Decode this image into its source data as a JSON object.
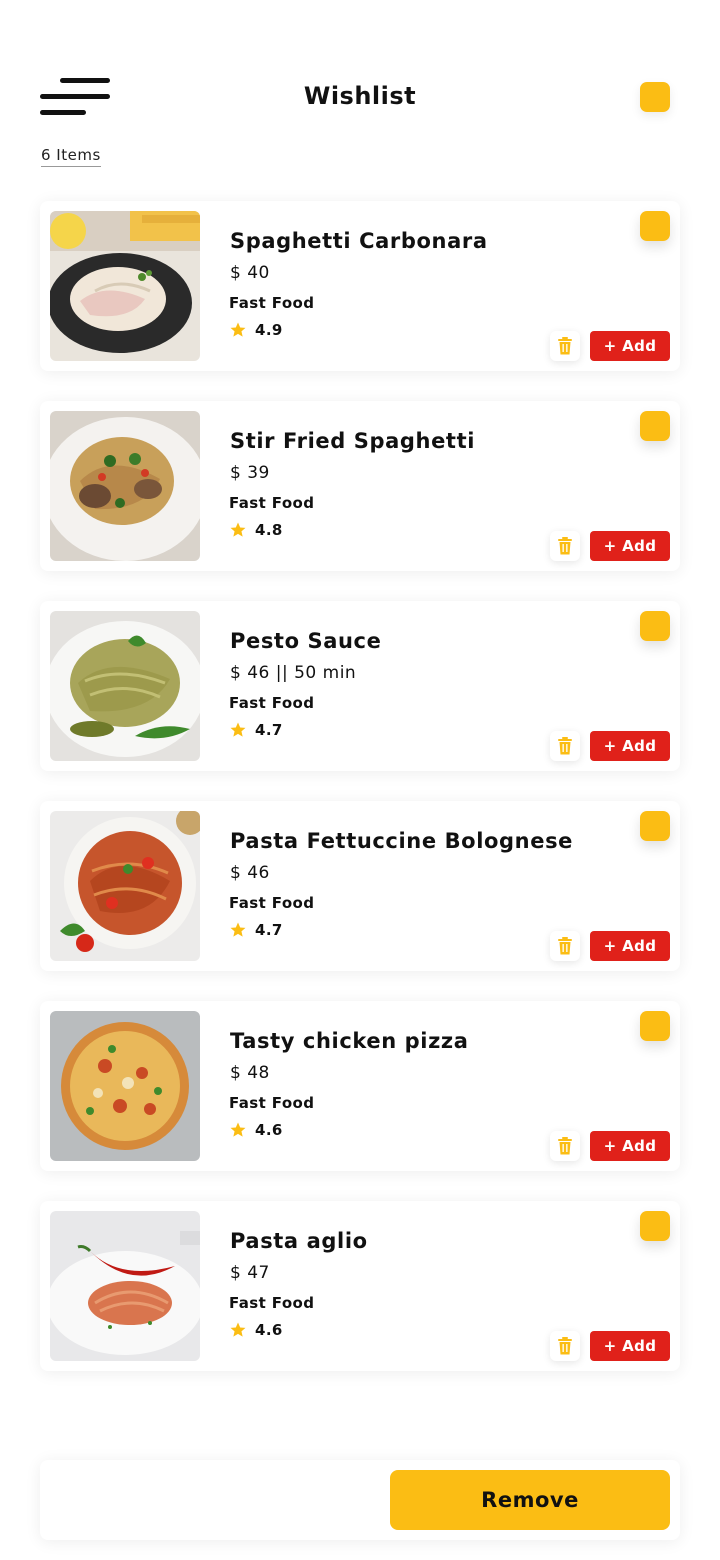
{
  "header": {
    "title": "Wishlist",
    "items_count": "6 Items",
    "menu_icon": "hamburger-menu-icon",
    "select_all_checked": true
  },
  "colors": {
    "accent_yellow": "#fbbd14",
    "add_red": "#e0211a"
  },
  "items": [
    {
      "name": "Spaghetti Carbonara",
      "price": "$ 40",
      "category": "Fast Food",
      "rating": "4.9",
      "add_label": "+ Add",
      "checked": true
    },
    {
      "name": "Stir Fried Spaghetti",
      "price": "$ 39",
      "category": "Fast Food",
      "rating": "4.8",
      "add_label": "+ Add",
      "checked": true
    },
    {
      "name": "Pesto Sauce",
      "price": "$ 46 || 50 min",
      "category": "Fast Food",
      "rating": "4.7",
      "add_label": "+ Add",
      "checked": true
    },
    {
      "name": "Pasta Fettuccine Bolognese",
      "price": "$ 46",
      "category": "Fast Food",
      "rating": "4.7",
      "add_label": "+ Add",
      "checked": true
    },
    {
      "name": "Tasty chicken pizza",
      "price": "$ 48",
      "category": "Fast Food",
      "rating": "4.6",
      "add_label": "+ Add",
      "checked": true
    },
    {
      "name": "Pasta aglio",
      "price": "$ 47",
      "category": "Fast Food",
      "rating": "4.6",
      "add_label": "+ Add",
      "checked": true
    }
  ],
  "footer": {
    "remove_label": "Remove"
  }
}
